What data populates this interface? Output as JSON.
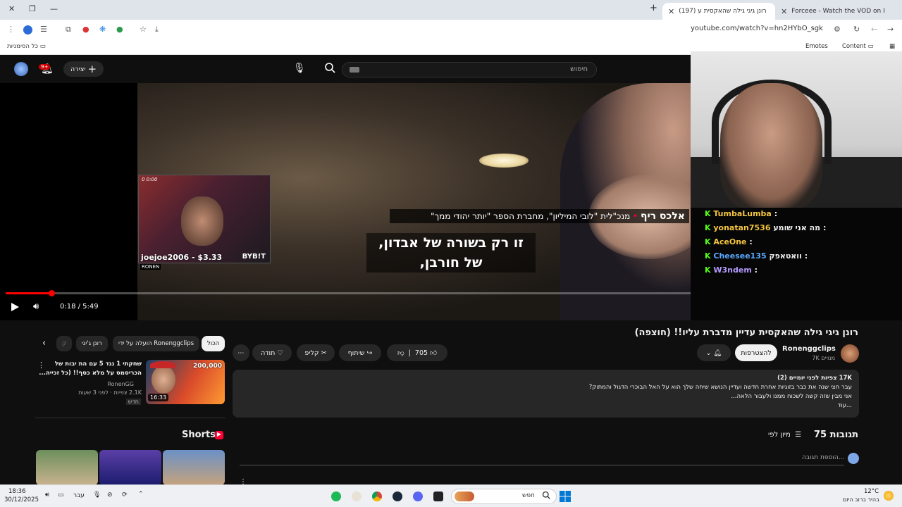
{
  "browser": {
    "tabs": [
      {
        "label": "Forceee - Watch the VOD on K",
        "favicon_color": "#53fc18"
      },
      {
        "label": "(197) רונן גיגי גילה שהאקסית ע",
        "favicon_color": "#ff0000"
      }
    ],
    "url": "youtube.com/watch?v=hn2HYbO_sgk",
    "bookmarks": {
      "all_bookmarks": "כל הסימניות",
      "emotes": "Emotes",
      "content": "Content"
    }
  },
  "youtube": {
    "search_placeholder": "חיפוש",
    "create_label": "יצירה",
    "notification_count": "9+",
    "player": {
      "current_time": "0:18 / 5:49",
      "progress_fraction": 0.052,
      "subtitle_line1": "זו רק בשורה של אבדון,",
      "subtitle_line2": "של חורבן,",
      "overlay_name": "אלכס ריף",
      "overlay_caption": "מנכ\"לית \"לובי המיליון\", מחברת הספר \"יותר יהודי ממך\"",
      "pip_donor": "joejoe2006 - $3.33",
      "pip_sponsor": "BYB!T",
      "pip_brand": "RONEN",
      "pip_stats": "0   0:00"
    },
    "stream_chat": [
      {
        "user": "TumbaLumba",
        "msg": ":",
        "color": "#f5c542"
      },
      {
        "user": "yonatan7536",
        "msg": "מה אני שומע :",
        "color": "#f5c542"
      },
      {
        "user": "AceOne",
        "msg": ":",
        "color": "#f5c542"
      },
      {
        "user": "Cheesee135",
        "msg": "וואטאפק :",
        "color": "#5aa9ff"
      },
      {
        "user": "W3ndem",
        "msg": ":",
        "color": "#b49bff"
      }
    ],
    "video": {
      "title": "רונן גיגי גילה שהאקסית עדיין מדברת עליו!! (חוצפה)",
      "channel": "Ronenggclips",
      "subscribers": "7K מנויים",
      "subscribe_label": "להצטרפות",
      "likes": "705",
      "share_label": "שיתוף",
      "clip_label": "קליפ",
      "thanks_label": "תודה",
      "views_line": "17K צפיות  לפני יומיים (2)",
      "description_line1": "עבר חצי שנה את כבר בזוגיות אחרת חדשה ועדיין הנושא שיחה שלך הוא על האל הבוכרי הדגול והמתוק?",
      "description_line2": "אני מבין שזה קשה לשכוח ממנו ולעבור הלאה...",
      "more_label": "...עוד",
      "comments_count": "75 תגובות",
      "sort_label": "מיון לפי",
      "add_comment": "הוספת תגובה..."
    },
    "filter_chips": [
      "הכול",
      "הועלה על ידי Ronenggclips",
      "רונן ג'יגי",
      "ק"
    ],
    "related": {
      "title_line1": "שחקתי 1 נגד 5 עם הת יבות של",
      "title_line2": "הכריסמס על מלא כסף!! (כל זכייה...",
      "channel": "RonenGG",
      "meta": "2.1K צפיות · לפני 3 שעות",
      "badge": "חדש",
      "duration": "16:33",
      "thumb_caption": "200,000"
    },
    "shorts_label": "Shorts"
  },
  "taskbar": {
    "time": "18:36",
    "date": "30/12/2025",
    "search": "חפש",
    "lang": "עבר",
    "weather_temp": "12°C",
    "weather_desc": "בהיר ברוב היום"
  }
}
